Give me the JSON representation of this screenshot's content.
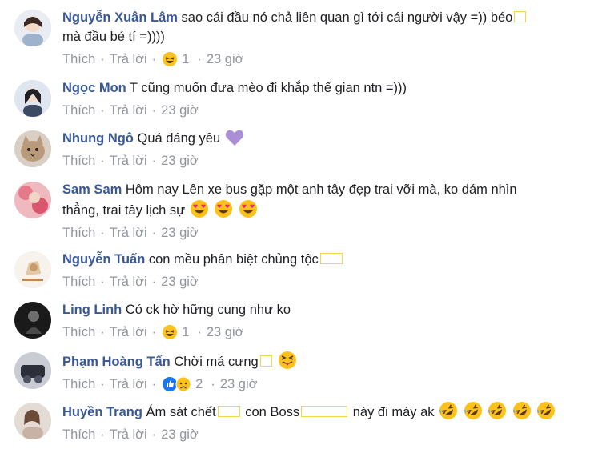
{
  "actions": {
    "like": "Thích",
    "reply": "Trả lời",
    "separator": "·"
  },
  "comments": [
    {
      "author": "Nguyễn Xuân Lâm",
      "text": "sao cái đầu nó chả liên quan gì tới cái người vậy =)) béo",
      "text2": "mà đầu bé tí =))))",
      "reaction_count": "1",
      "time": "23 giờ"
    },
    {
      "author": "Ngọc Mon",
      "text": "T cũng muốn đưa mèo đi khắp thế gian ntn =)))",
      "time": "23 giờ"
    },
    {
      "author": "Nhung Ngô",
      "text": "Quá đáng yêu",
      "time": "23 giờ"
    },
    {
      "author": "Sam Sam",
      "text": "Hôm nay Lên xe bus gặp một anh tây đẹp trai vỡi mà, ko dám nhìn",
      "text2": "thẳng, trai tây lịch sự",
      "time": "23 giờ"
    },
    {
      "author": "Nguyễn Tuấn",
      "text": "con mều phân biệt chủng tộc",
      "time": "23 giờ"
    },
    {
      "author": "Ling Linh",
      "text": "Có ck hờ hững cung như ko",
      "reaction_count": "1",
      "time": "23 giờ"
    },
    {
      "author": "Phạm Hoàng Tấn",
      "text": "Chời má cưng",
      "reaction_count": "2",
      "time": "23 giờ"
    },
    {
      "author": "Huyền Trang",
      "text": "Ám sát chết",
      "text_b": "con Boss",
      "text_c": "này đi mày ak",
      "time": "23 giờ"
    }
  ],
  "colors": {
    "author": "#385898",
    "meta": "#90949c",
    "text": "#1c1e21",
    "emoji_face": "#fcc21b",
    "heart": "#aa8ed6",
    "like_blue": "#1877f2",
    "missing_glyph_box": "#f1d84a"
  }
}
